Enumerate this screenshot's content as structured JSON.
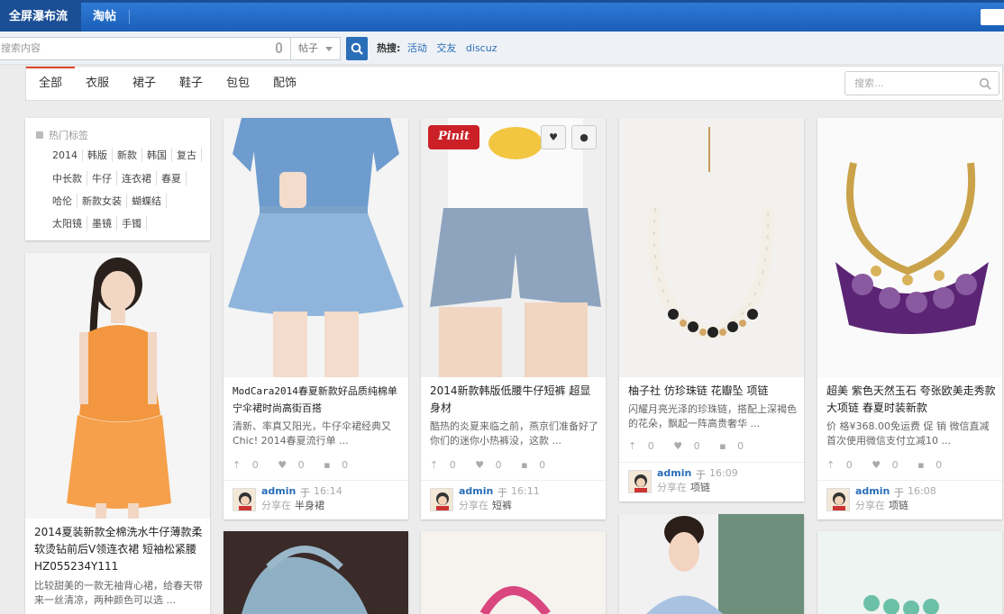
{
  "topbar": {
    "tabs": [
      "全屏瀑布流",
      "淘帖"
    ]
  },
  "search": {
    "placeholder": "搜索内容",
    "scope": "帖子",
    "hot_label": "热搜:",
    "hot_keywords": [
      "活动",
      "交友",
      "discuz"
    ]
  },
  "categories": [
    "全部",
    "衣服",
    "裙子",
    "鞋子",
    "包包",
    "配饰"
  ],
  "cat_search_placeholder": "搜索...",
  "tags": {
    "title": "热门标签",
    "rows": [
      [
        "2014",
        "韩版",
        "新款",
        "韩国",
        "复古"
      ],
      [
        "中长款",
        "牛仔",
        "连衣裙",
        "春夏"
      ],
      [
        "哈伦",
        "新款女装",
        "蝴蝶结"
      ],
      [
        "太阳镜",
        "墨镜",
        "手镯"
      ]
    ]
  },
  "pinit_label": "Pinit",
  "stats_zero": "0",
  "cards": [
    {
      "title": "2014夏装新款全棉洗水牛仔薄款柔软烫钻前后V领连衣裙 短袖松紧腰HZ055234Y111",
      "desc": "比较甜美的一款无袖背心裙，给春天带来一丝清凉，两种颜色可以选 ..."
    },
    {
      "title": "ModCara2014春夏新款好品质纯棉单宁伞裙时尚高街百搭",
      "desc": "清新、率真又阳光，牛仔伞裙经典又Chic! 2014春夏流行单 ...",
      "user": "admin",
      "yu": "于",
      "time": "16:14",
      "share": "分享在",
      "board": "半身裙"
    },
    {
      "title": "2014新款韩版低腰牛仔短裤 超显身材",
      "desc": "酷热的炎夏来临之前，燕京们准备好了你们的迷你小热裤没，这款 ...",
      "user": "admin",
      "yu": "于",
      "time": "16:11",
      "share": "分享在",
      "board": "短裤"
    },
    {
      "title": "柚子社 仿珍珠链 花瓣坠 项链",
      "desc": "闪耀月亮光泽的珍珠链，搭配上深褐色的花朵，飘起一阵高贵奢华 ...",
      "user": "admin",
      "yu": "于",
      "time": "16:09",
      "share": "分享在",
      "board": "项链"
    },
    {
      "title": "超美 紫色天然玉石 夸张欧美走秀款大项链 春夏时装新款",
      "desc": "价 格¥368.00免运费 促 销 微信直减首次使用微信支付立减10 ...",
      "user": "admin",
      "yu": "于",
      "time": "16:08",
      "share": "分享在",
      "board": "项链"
    }
  ],
  "colors": {
    "topbar": "#1a5fb8",
    "accent_red": "#e0462b",
    "link_blue": "#2a6eb8",
    "pinit_red": "#cb2027"
  }
}
